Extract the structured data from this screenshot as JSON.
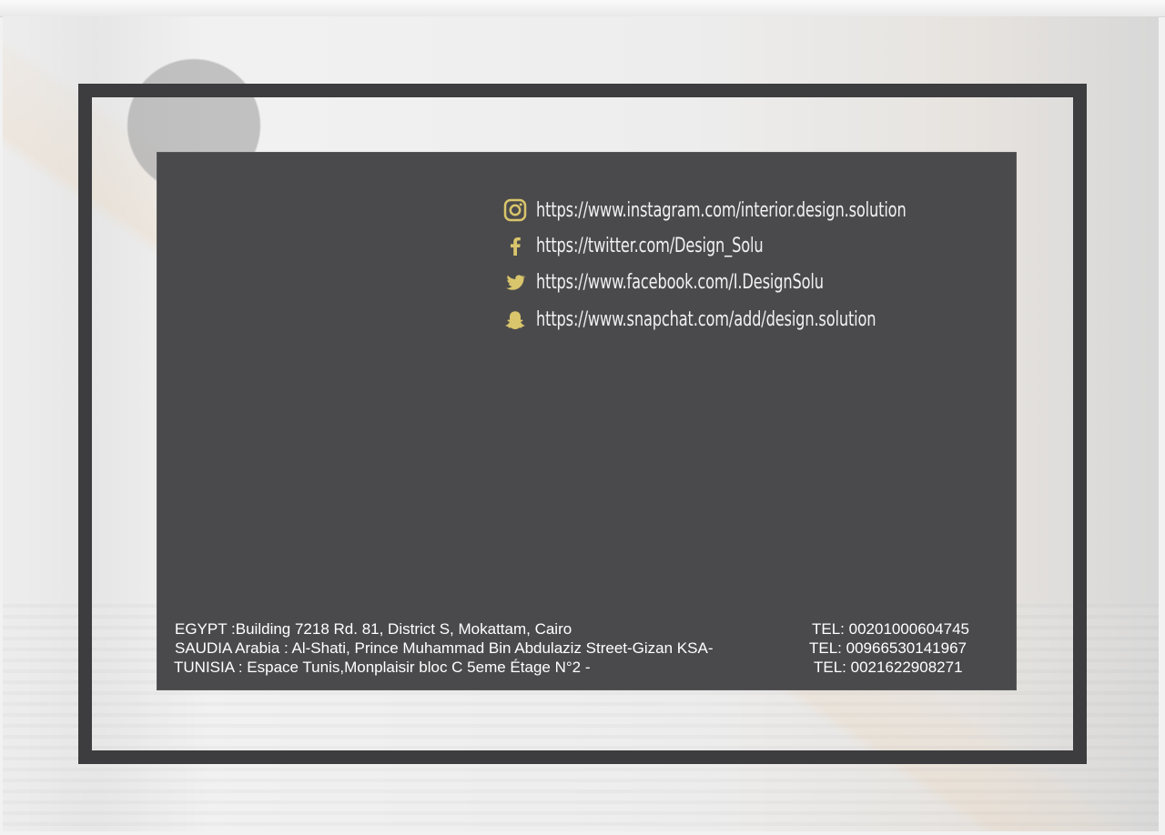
{
  "colors": {
    "frame": "#3d3d3f",
    "card": "#4a4a4c",
    "icon_gold": "#d9c56b",
    "text": "#ffffff"
  },
  "social_links": [
    {
      "icon": "instagram-icon",
      "text": "https://www.instagram.com/interior.design.solution"
    },
    {
      "icon": "facebook-icon",
      "text": "https://twitter.com/Design_Solu"
    },
    {
      "icon": "twitter-icon",
      "text": "https://www.facebook.com/I.DesignSolu"
    },
    {
      "icon": "snapchat-icon",
      "text": "https://www.snapchat.com/add/design.solution"
    }
  ],
  "contacts": [
    {
      "address": "EGYPT :Building 7218 Rd. 81, District S, Mokattam, Cairo",
      "tel": "TEL:  00201000604745"
    },
    {
      "address": "SAUDIA Arabia : Al-Shati,  Prince Muhammad Bin Abdulaziz Street-Gizan KSA-",
      "tel": "TEL:  00966530141967"
    },
    {
      "address": "TUNISIA : Espace Tunis,Monplaisir bloc C 5eme Étage N°2 -",
      "tel": "TEL:  0021622908271"
    }
  ]
}
